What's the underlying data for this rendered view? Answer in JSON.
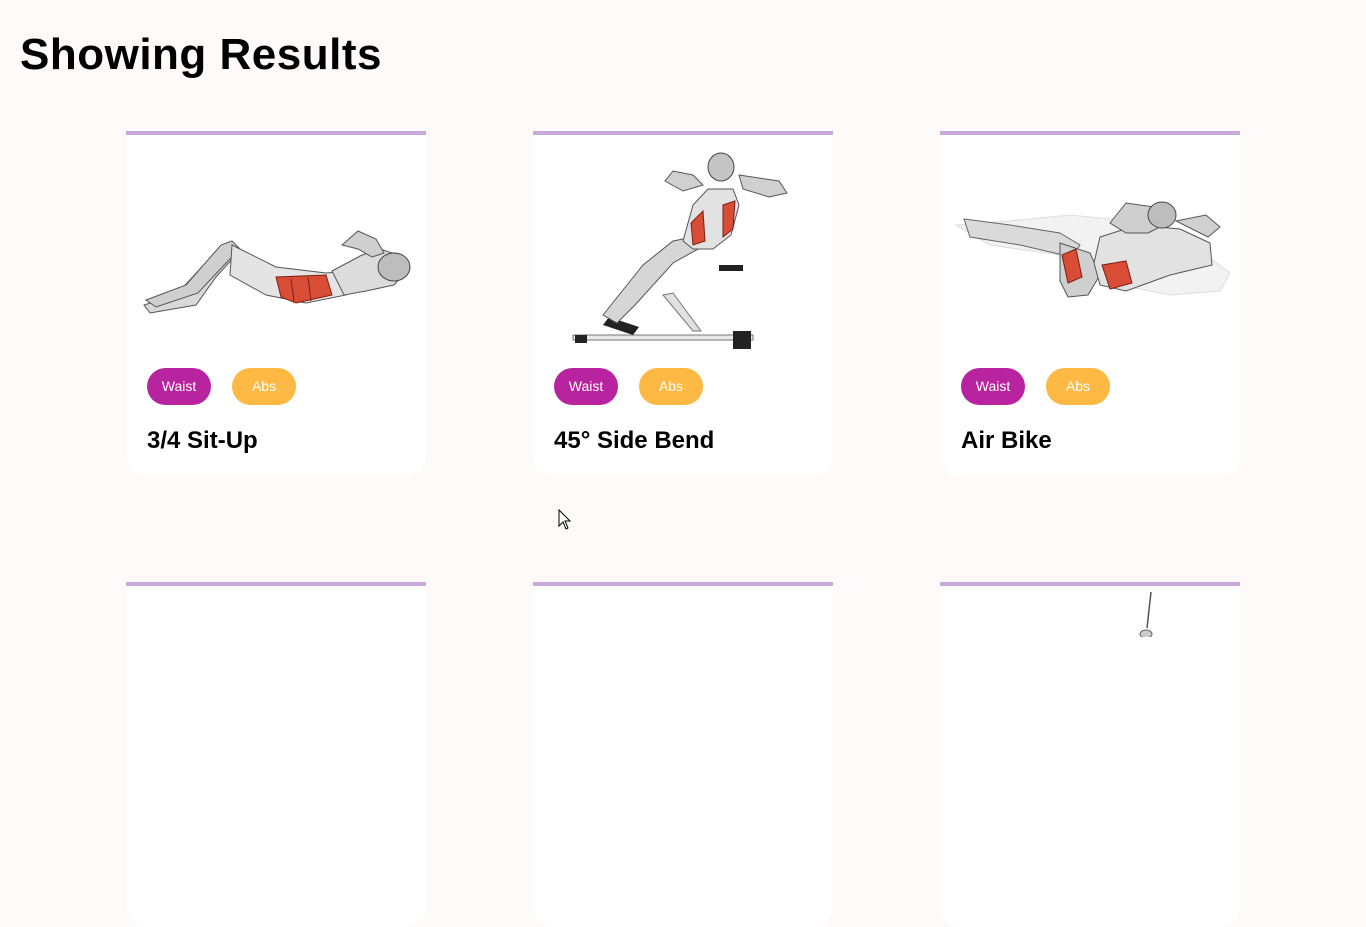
{
  "page": {
    "title": "Showing Results"
  },
  "colors": {
    "background": "#fffafa",
    "card_top_border": "#c9a9d9",
    "body_part_tag": "#b8239f",
    "target_tag": "#fdb943"
  },
  "exercises": [
    {
      "name": "3/4 Sit-Up",
      "body_part": "Waist",
      "target": "Abs",
      "image": "sit-up-illustration"
    },
    {
      "name": "45° Side Bend",
      "body_part": "Waist",
      "target": "Abs",
      "image": "side-bend-illustration"
    },
    {
      "name": "Air Bike",
      "body_part": "Waist",
      "target": "Abs",
      "image": "air-bike-illustration"
    }
  ]
}
